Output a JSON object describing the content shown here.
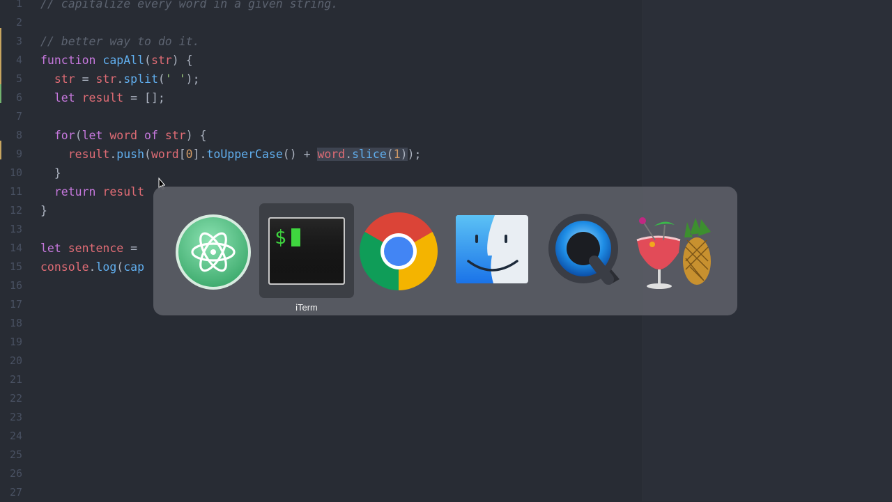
{
  "editor": {
    "lines": [
      {
        "n": "1",
        "tokens": [
          {
            "c": "cm",
            "t": "// capitalize every word in a given string."
          }
        ]
      },
      {
        "n": "2",
        "tokens": []
      },
      {
        "n": "3",
        "tokens": [
          {
            "c": "cm",
            "t": "// better way to do it."
          }
        ]
      },
      {
        "n": "4",
        "tokens": [
          {
            "c": "kw",
            "t": "function "
          },
          {
            "c": "fn",
            "t": "capAll"
          },
          {
            "c": "",
            "t": "("
          },
          {
            "c": "var",
            "t": "str"
          },
          {
            "c": "",
            "t": ") {"
          }
        ]
      },
      {
        "n": "5",
        "tokens": [
          {
            "c": "",
            "t": "  "
          },
          {
            "c": "var",
            "t": "str"
          },
          {
            "c": "",
            "t": " = "
          },
          {
            "c": "var",
            "t": "str"
          },
          {
            "c": "",
            "t": "."
          },
          {
            "c": "fn",
            "t": "split"
          },
          {
            "c": "",
            "t": "("
          },
          {
            "c": "str",
            "t": "' '"
          },
          {
            "c": "",
            "t": ");"
          }
        ]
      },
      {
        "n": "6",
        "tokens": [
          {
            "c": "",
            "t": "  "
          },
          {
            "c": "kw",
            "t": "let "
          },
          {
            "c": "var",
            "t": "result"
          },
          {
            "c": "",
            "t": " = [];"
          }
        ]
      },
      {
        "n": "7",
        "tokens": []
      },
      {
        "n": "8",
        "tokens": [
          {
            "c": "",
            "t": "  "
          },
          {
            "c": "kw",
            "t": "for"
          },
          {
            "c": "",
            "t": "("
          },
          {
            "c": "kw",
            "t": "let "
          },
          {
            "c": "var",
            "t": "word"
          },
          {
            "c": "kw",
            "t": " of "
          },
          {
            "c": "var",
            "t": "str"
          },
          {
            "c": "",
            "t": ") {"
          }
        ]
      },
      {
        "n": "9",
        "tokens": [
          {
            "c": "",
            "t": "    "
          },
          {
            "c": "var",
            "t": "result"
          },
          {
            "c": "",
            "t": "."
          },
          {
            "c": "fn",
            "t": "push"
          },
          {
            "c": "",
            "t": "("
          },
          {
            "c": "var",
            "t": "word"
          },
          {
            "c": "",
            "t": "["
          },
          {
            "c": "num",
            "t": "0"
          },
          {
            "c": "",
            "t": "]."
          },
          {
            "c": "fn",
            "t": "toUpperCase"
          },
          {
            "c": "",
            "t": "() + "
          },
          {
            "c": "var sel",
            "t": "word"
          },
          {
            "c": "sel",
            "t": "."
          },
          {
            "c": "fn sel",
            "t": "slice"
          },
          {
            "c": "sel",
            "t": "("
          },
          {
            "c": "num sel",
            "t": "1"
          },
          {
            "c": "sel",
            "t": ")"
          },
          {
            "c": "",
            "t": ");"
          }
        ]
      },
      {
        "n": "10",
        "tokens": [
          {
            "c": "",
            "t": "  }"
          }
        ]
      },
      {
        "n": "11",
        "tokens": [
          {
            "c": "",
            "t": "  "
          },
          {
            "c": "kw",
            "t": "return "
          },
          {
            "c": "var",
            "t": "result"
          }
        ]
      },
      {
        "n": "12",
        "tokens": [
          {
            "c": "",
            "t": "}"
          }
        ]
      },
      {
        "n": "13",
        "tokens": []
      },
      {
        "n": "14",
        "tokens": [
          {
            "c": "kw",
            "t": "let "
          },
          {
            "c": "var",
            "t": "sentence"
          },
          {
            "c": "",
            "t": " ="
          }
        ]
      },
      {
        "n": "15",
        "tokens": [
          {
            "c": "var",
            "t": "console"
          },
          {
            "c": "",
            "t": "."
          },
          {
            "c": "fn",
            "t": "log"
          },
          {
            "c": "",
            "t": "("
          },
          {
            "c": "fn",
            "t": "cap"
          }
        ]
      },
      {
        "n": "16",
        "tokens": []
      },
      {
        "n": "17",
        "tokens": []
      },
      {
        "n": "18",
        "tokens": []
      },
      {
        "n": "19",
        "tokens": []
      },
      {
        "n": "20",
        "tokens": []
      },
      {
        "n": "21",
        "tokens": []
      },
      {
        "n": "22",
        "tokens": []
      },
      {
        "n": "23",
        "tokens": []
      },
      {
        "n": "24",
        "tokens": []
      },
      {
        "n": "25",
        "tokens": []
      },
      {
        "n": "26",
        "tokens": []
      },
      {
        "n": "27",
        "tokens": []
      }
    ]
  },
  "app_switcher": {
    "apps": [
      {
        "name": "atom-icon",
        "selected": false
      },
      {
        "name": "iterm-icon",
        "selected": true
      },
      {
        "name": "chrome-icon",
        "selected": false
      },
      {
        "name": "finder-icon",
        "selected": false
      },
      {
        "name": "quicktime-icon",
        "selected": false
      },
      {
        "name": "handbrake-icon",
        "selected": false
      }
    ],
    "selected_label": "iTerm",
    "terminal_prompt": "$"
  },
  "colors": {
    "editor_bg": "#282c34",
    "keyword": "#c678dd",
    "function": "#61afef",
    "variable": "#e06c75",
    "string": "#98c379",
    "number": "#d19a66",
    "comment": "#5c6370",
    "gutter_modified": "#e5c07b",
    "gutter_added": "#98c379"
  }
}
